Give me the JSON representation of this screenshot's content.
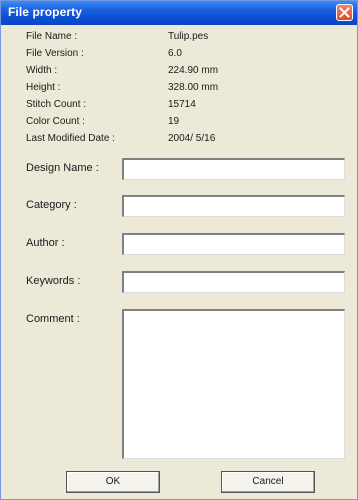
{
  "window": {
    "title": "File property",
    "close_icon": "close-icon"
  },
  "info": [
    {
      "label": "File Name :",
      "value": "Tulip.pes"
    },
    {
      "label": "File Version :",
      "value": "6.0"
    },
    {
      "label": "Width :",
      "value": "224.90  mm"
    },
    {
      "label": "Height :",
      "value": "328.00  mm"
    },
    {
      "label": "Stitch Count :",
      "value": "15714"
    },
    {
      "label": "Color Count :",
      "value": "19"
    },
    {
      "label": "Last Modified Date :",
      "value": "2004/ 5/16"
    }
  ],
  "fields": {
    "design_name": {
      "label": "Design Name :",
      "value": ""
    },
    "category": {
      "label": "Category :",
      "value": ""
    },
    "author": {
      "label": "Author :",
      "value": ""
    },
    "keywords": {
      "label": "Keywords :",
      "value": ""
    },
    "comment": {
      "label": "Comment :",
      "value": ""
    }
  },
  "buttons": {
    "ok": "OK",
    "cancel": "Cancel"
  },
  "colors": {
    "titlebar": "#0a4fd4",
    "window_bg": "#ece9d8",
    "close_button": "#d74a2a"
  }
}
